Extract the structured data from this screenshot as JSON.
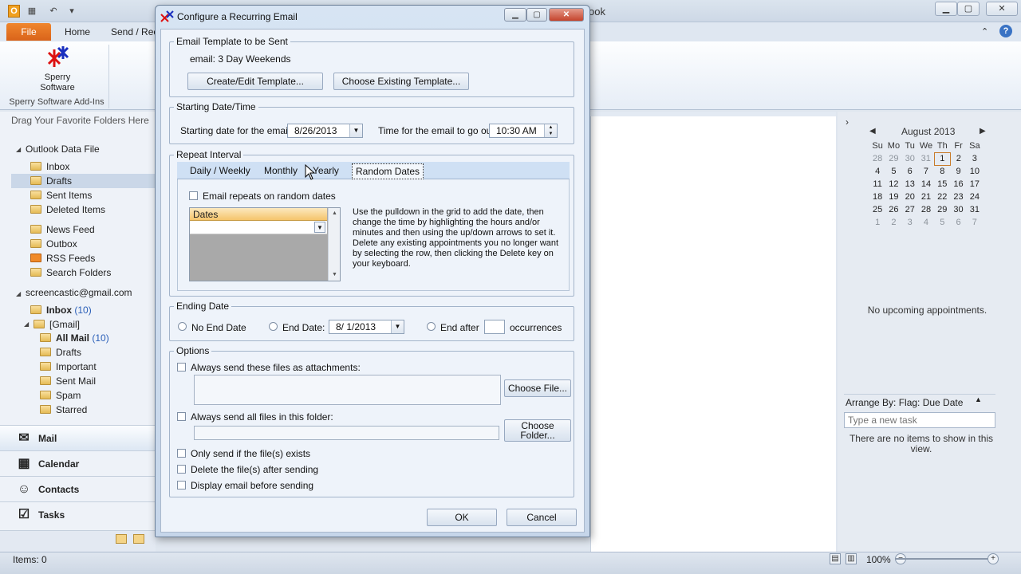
{
  "app": {
    "title": "ook",
    "file_tab": "File",
    "ribbon_tabs": [
      "Home",
      "Send / Rec"
    ],
    "sperry_button": [
      "Sperry",
      "Software"
    ],
    "addins_group": "Sperry Software Add-Ins",
    "drag_hint": "Drag Your Favorite Folders Here"
  },
  "nav": {
    "account1": "Outlook Data File",
    "folders1": [
      {
        "label": "Inbox"
      },
      {
        "label": "Drafts"
      },
      {
        "label": "Sent Items"
      },
      {
        "label": "Deleted Items"
      },
      {
        "label": "News Feed"
      },
      {
        "label": "Outbox"
      },
      {
        "label": "RSS Feeds"
      },
      {
        "label": "Search Folders"
      }
    ],
    "account2": "screencastic@gmail.com",
    "inbox_label": "Inbox",
    "inbox_count": "(10)",
    "gmail_label": "[Gmail]",
    "allmail_label": "All Mail",
    "allmail_count": "(10)",
    "gmail_folders": [
      "Drafts",
      "Important",
      "Sent Mail",
      "Spam",
      "Starred"
    ],
    "modules": [
      "Mail",
      "Calendar",
      "Contacts",
      "Tasks"
    ]
  },
  "todo": {
    "month": "August 2013",
    "weekdays": [
      "Su",
      "Mo",
      "Tu",
      "We",
      "Th",
      "Fr",
      "Sa"
    ],
    "weeks": [
      [
        "28",
        "29",
        "30",
        "31",
        "1",
        "2",
        "3"
      ],
      [
        "4",
        "5",
        "6",
        "7",
        "8",
        "9",
        "10"
      ],
      [
        "11",
        "12",
        "13",
        "14",
        "15",
        "16",
        "17"
      ],
      [
        "18",
        "19",
        "20",
        "21",
        "22",
        "23",
        "24"
      ],
      [
        "25",
        "26",
        "27",
        "28",
        "29",
        "30",
        "31"
      ],
      [
        "1",
        "2",
        "3",
        "4",
        "5",
        "6",
        "7"
      ]
    ],
    "no_appointments": "No upcoming appointments.",
    "arrange_by": "Arrange By: Flag: Due Date",
    "task_placeholder": "Type a new task",
    "no_items": "There are no items to show in this view."
  },
  "status": {
    "items": "Items: 0",
    "zoom": "100%"
  },
  "dialog": {
    "title": "Configure a Recurring Email",
    "template_group": "Email Template to be Sent",
    "template_name": "email: 3 Day Weekends",
    "create_edit_btn": "Create/Edit Template...",
    "choose_existing_btn": "Choose Existing Template...",
    "starting_group": "Starting Date/Time",
    "start_date_label": "Starting date for the email:",
    "start_date_value": "8/26/2013",
    "time_label": "Time for the email to go out:",
    "time_value": "10:30 AM",
    "repeat_group": "Repeat Interval",
    "tabs": [
      "Daily / Weekly",
      "Monthly",
      "Yearly",
      "Random Dates"
    ],
    "random_checkbox": "Email repeats on random dates",
    "dates_header": "Dates",
    "help_text": "Use the pulldown in the grid to add the date, then change the time by highlighting the hours and/or minutes and then using the up/down arrows to set it. Delete any existing appointments you no longer want by selecting the row, then clicking the Delete key on your keyboard.",
    "ending_group": "Ending Date",
    "no_end_date": "No End Date",
    "end_date_label": "End Date:",
    "end_date_value": "8/  1/2013",
    "end_after_label": "End after",
    "end_after_value": "",
    "occurrences": "occurrences",
    "options_group": "Options",
    "attach_files_label": "Always send these files as attachments:",
    "choose_file_btn": "Choose File...",
    "folder_label": "Always send all files in this folder:",
    "choose_folder_btn": [
      "Choose",
      "Folder..."
    ],
    "only_if_exists": "Only send if the file(s) exists",
    "delete_after": "Delete the file(s) after sending",
    "display_before": "Display email before sending",
    "ok_btn": "OK",
    "cancel_btn": "Cancel"
  },
  "colors": {
    "file_tab": "#e0701f",
    "selection": "#cad7e8",
    "dialog_frame": "#c6d6ea",
    "dates_header": "#f5c46b"
  }
}
